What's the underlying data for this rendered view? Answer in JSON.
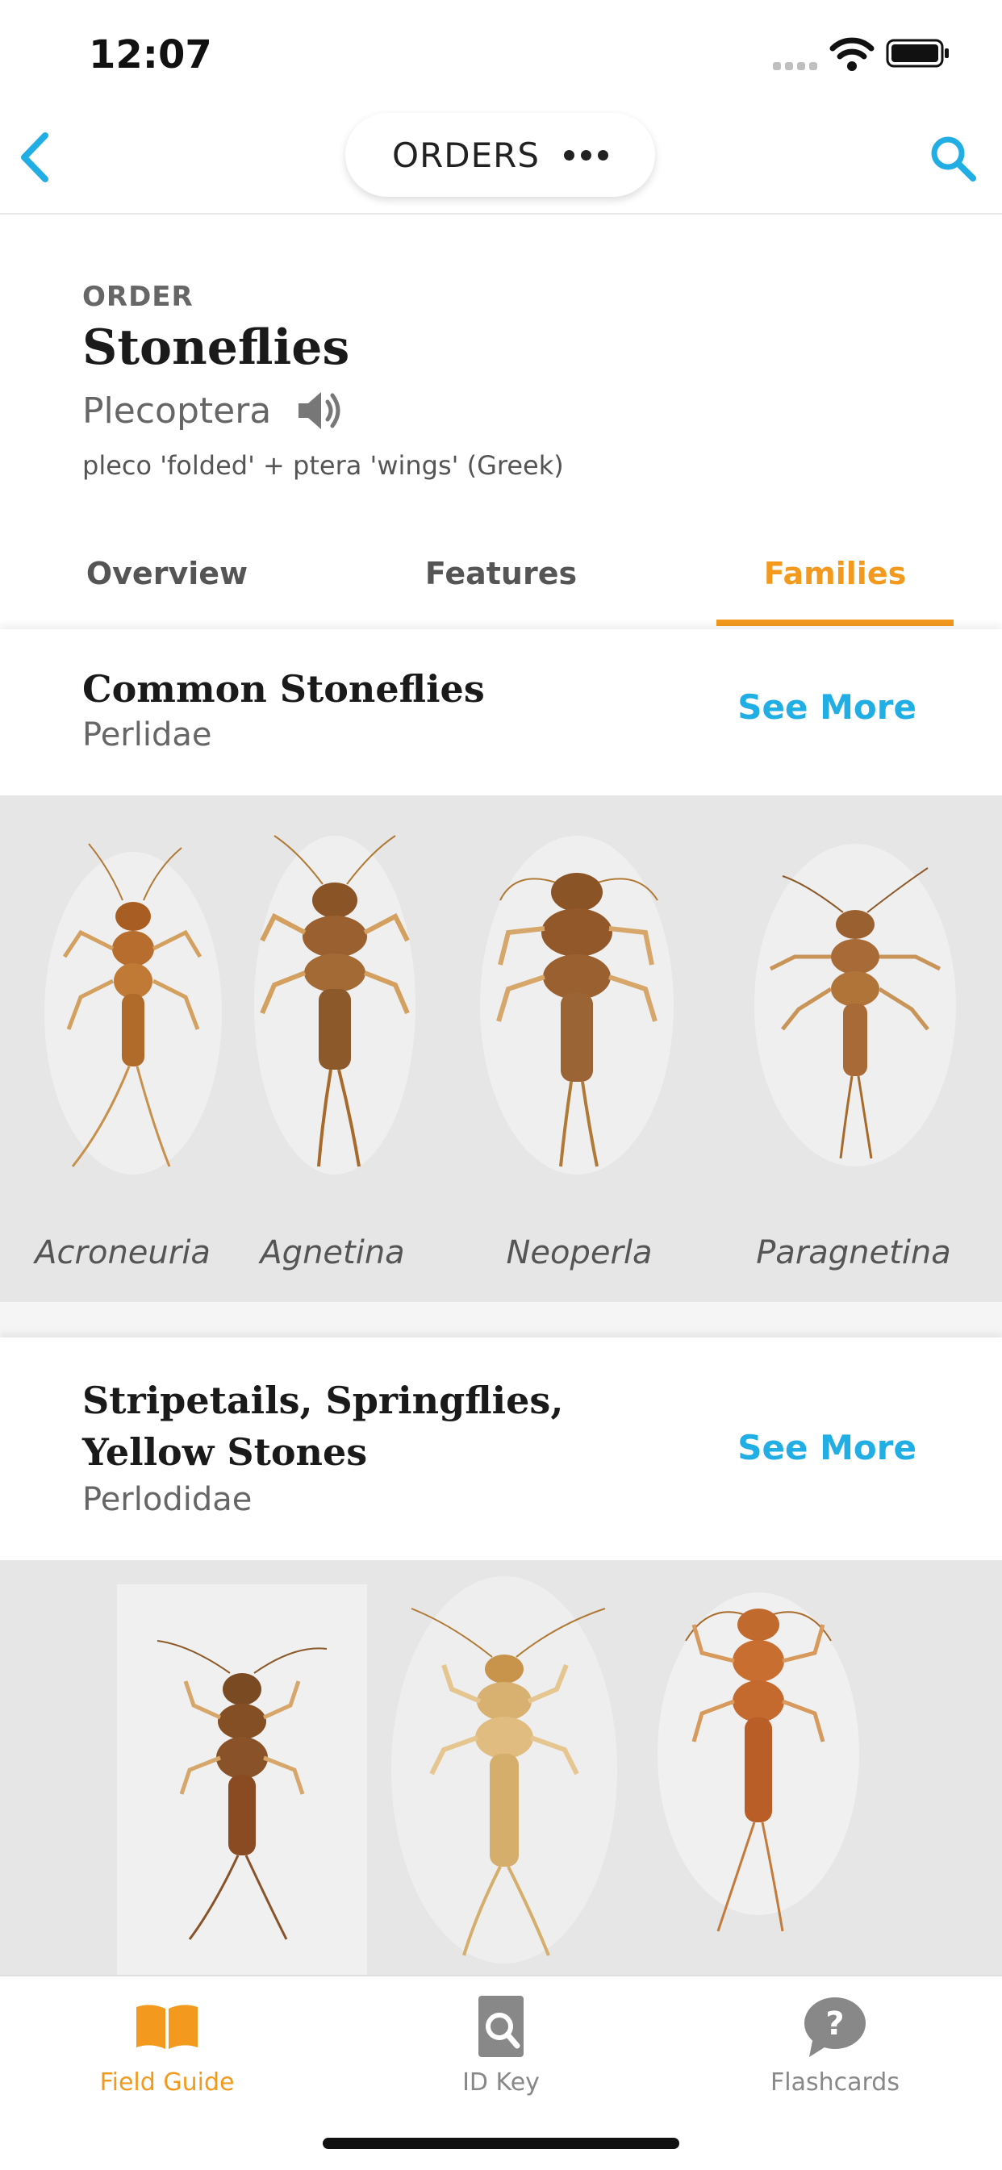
{
  "status_bar": {
    "time": "12:07"
  },
  "nav": {
    "title": "ORDERS",
    "icons": [
      "back-icon",
      "more-dots-icon",
      "search-icon"
    ]
  },
  "order": {
    "tag": "ORDER",
    "common_name": "Stoneflies",
    "latin_name": "Plecoptera",
    "etymology": "pleco 'folded' + ptera 'wings' (Greek)"
  },
  "tabs": [
    {
      "label": "Overview",
      "active": false
    },
    {
      "label": "Features",
      "active": false
    },
    {
      "label": "Families",
      "active": true
    }
  ],
  "families": [
    {
      "title": "Common Stoneflies",
      "latin": "Perlidae",
      "see_more": "See More",
      "genera": [
        "Acroneuria",
        "Agnetina",
        "Neoperla",
        "Paragnetina"
      ]
    },
    {
      "title": "Stripetails, Springflies, Yellow Stones",
      "latin": "Perlodidae",
      "see_more": "See More",
      "genera": []
    }
  ],
  "tabbar": [
    {
      "label": "Field Guide",
      "icon": "book-icon",
      "active": true
    },
    {
      "label": "ID Key",
      "icon": "id-key-icon",
      "active": false
    },
    {
      "label": "Flashcards",
      "icon": "question-bubble-icon",
      "active": false
    }
  ],
  "colors": {
    "accent": "#f39a1e",
    "link": "#21aee4",
    "gallery_bg": "#e6e6e6"
  }
}
